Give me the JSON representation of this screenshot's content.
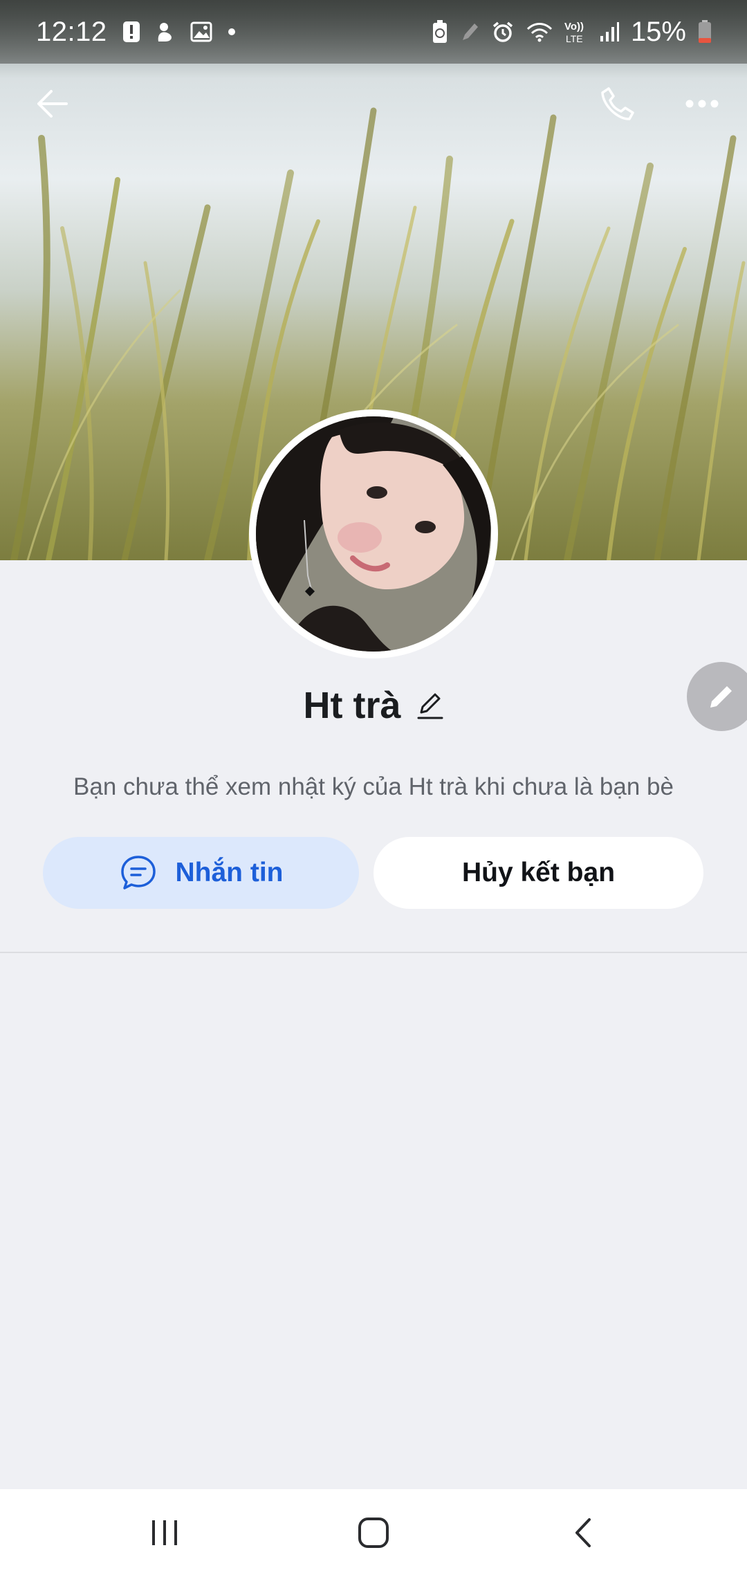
{
  "status_bar": {
    "time": "12:12",
    "battery": "15%",
    "left_icons": [
      "alert-icon",
      "duck-icon",
      "gallery-icon",
      "dot-icon"
    ],
    "right_icons": [
      "battery-saver-icon",
      "pen-icon",
      "alarm-icon",
      "wifi-icon",
      "volte-icon",
      "signal-icon",
      "battery-icon"
    ]
  },
  "top_bar": {
    "icons": [
      "back-arrow-icon",
      "phone-icon",
      "more-icon"
    ]
  },
  "profile": {
    "name": "Ht trà",
    "notice": "Bạn chưa thể xem nhật ký của Ht trà khi chưa là bạn bè"
  },
  "actions": {
    "message_label": "Nhắn tin",
    "unfriend_label": "Hủy kết bạn"
  },
  "colors": {
    "accent": "#1d5fd9",
    "accent_bg": "#dce8fc",
    "page_bg": "#eff0f4"
  },
  "nav_bar": {
    "icons": [
      "recents-icon",
      "home-icon",
      "back-icon"
    ]
  }
}
